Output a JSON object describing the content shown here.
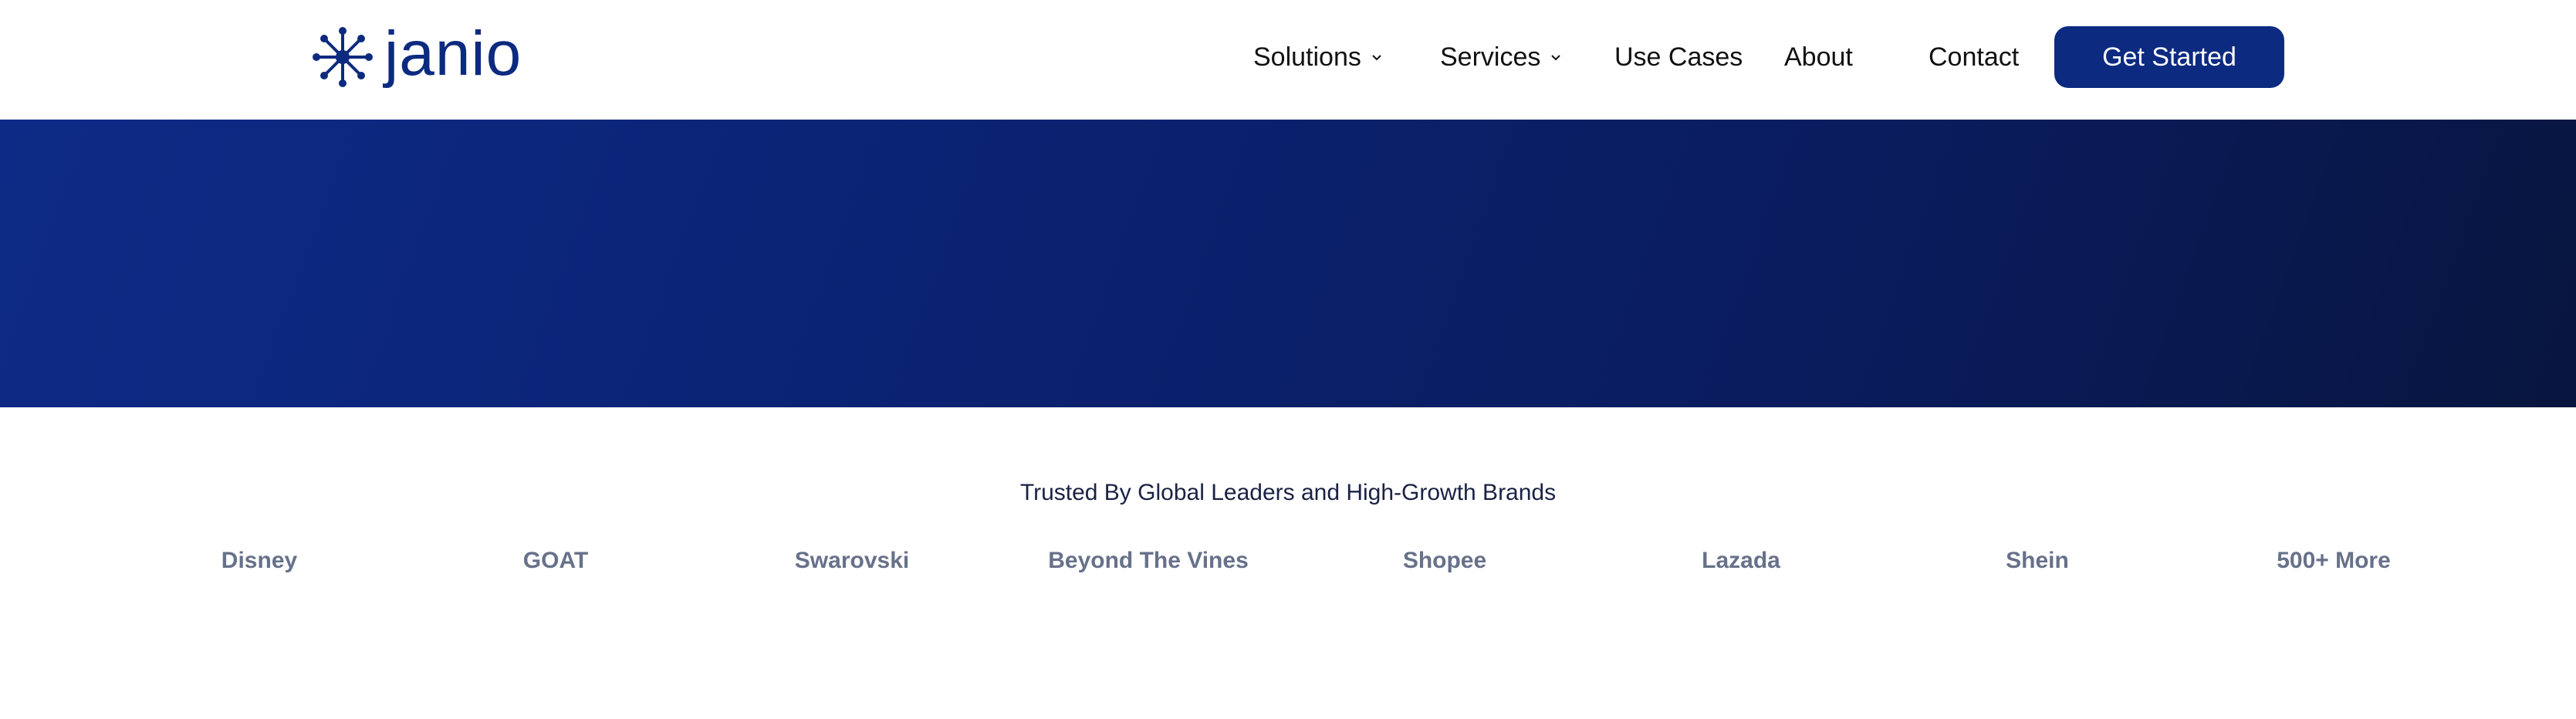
{
  "header": {
    "logo_text": "janio",
    "nav": [
      {
        "label": "Solutions",
        "has_dropdown": true
      },
      {
        "label": "Services",
        "has_dropdown": true
      },
      {
        "label": "Use Cases",
        "has_dropdown": false
      },
      {
        "label": "About",
        "has_dropdown": false
      },
      {
        "label": "Contact",
        "has_dropdown": false
      }
    ],
    "cta_label": "Get Started"
  },
  "colors": {
    "brand_navy": "#0c2a7f",
    "hero_start": "#0d2a86",
    "hero_end": "#08153f",
    "brand_text": "#67718a"
  },
  "trusted": {
    "heading": "Trusted By Global Leaders and High-Growth Brands",
    "brands": [
      "Disney",
      "GOAT",
      "Swarovski",
      "Beyond The Vines",
      "Shopee",
      "Lazada",
      "Shein",
      "500+ More"
    ]
  }
}
